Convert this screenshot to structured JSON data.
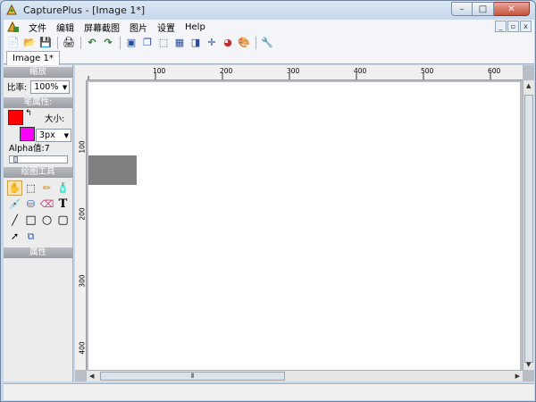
{
  "window": {
    "title": "CapturePlus - [Image 1*]"
  },
  "window_controls": {
    "minimize": "–",
    "maximize": "□",
    "close": "✕"
  },
  "menu": {
    "items": [
      "文件",
      "编辑",
      "屏幕截图",
      "图片",
      "设置",
      "Help"
    ]
  },
  "mdi_controls": {
    "minimize": "_",
    "restore": "▫",
    "close": "x"
  },
  "toolbar": {
    "buttons": [
      {
        "name": "new-file-icon",
        "glyph": "📄"
      },
      {
        "name": "open-folder-icon",
        "glyph": "📂"
      },
      {
        "name": "save-icon",
        "glyph": "💾"
      },
      {
        "name": "print-icon",
        "glyph": "🖨"
      },
      {
        "name": "undo-icon",
        "glyph": "↶"
      },
      {
        "name": "redo-icon",
        "glyph": "↷"
      },
      {
        "name": "capture-fullscreen-icon",
        "glyph": "▣"
      },
      {
        "name": "capture-window-icon",
        "glyph": "❐"
      },
      {
        "name": "capture-region-icon",
        "glyph": "⬚"
      },
      {
        "name": "capture-scroll-icon",
        "glyph": "▦"
      },
      {
        "name": "capture-object-icon",
        "glyph": "◨"
      },
      {
        "name": "crosshair-icon",
        "glyph": "✛"
      },
      {
        "name": "color-picker-icon",
        "glyph": "◕"
      },
      {
        "name": "palette-icon",
        "glyph": "🎨"
      },
      {
        "name": "settings-wrench-icon",
        "glyph": "🔧"
      }
    ]
  },
  "tab": {
    "label": "Image 1*"
  },
  "panel": {
    "zoom_header": "缩放",
    "zoom_label": "比率:",
    "zoom_value": "100%",
    "pen_header": "笔属性:",
    "size_label": "大小:",
    "size_value": "3px",
    "alpha_label": "Alpha值:7",
    "alpha_level": 0.07,
    "tools_header": "绘图工具",
    "props_header": "属性",
    "fg_color": "#ff0000",
    "bg_color": "#ff00ff",
    "tools": [
      {
        "name": "hand-tool-icon",
        "glyph": "✋",
        "active": true
      },
      {
        "name": "rect-select-icon",
        "glyph": "⬚"
      },
      {
        "name": "pencil-icon",
        "glyph": "✏"
      },
      {
        "name": "spray-icon",
        "glyph": "🧴"
      },
      {
        "name": "eyedropper-icon",
        "glyph": "💉"
      },
      {
        "name": "fill-bucket-icon",
        "glyph": "⛁"
      },
      {
        "name": "eraser-icon",
        "glyph": "⌫"
      },
      {
        "name": "text-tool-icon",
        "glyph": "T"
      },
      {
        "name": "line-tool-icon",
        "glyph": "╱"
      },
      {
        "name": "rectangle-tool-icon",
        "glyph": "□"
      },
      {
        "name": "ellipse-tool-icon",
        "glyph": "○"
      },
      {
        "name": "rounded-rect-tool-icon",
        "glyph": "▢"
      },
      {
        "name": "arrow-tool-icon",
        "glyph": "➚"
      },
      {
        "name": "stamp-tool-icon",
        "glyph": "⧉"
      }
    ]
  },
  "rulers": {
    "horizontal": [
      "100",
      "200",
      "300",
      "400",
      "500",
      "600"
    ],
    "vertical": [
      "100",
      "200",
      "300",
      "400"
    ]
  },
  "scroll": {
    "hthumb_grip": "⦀"
  }
}
